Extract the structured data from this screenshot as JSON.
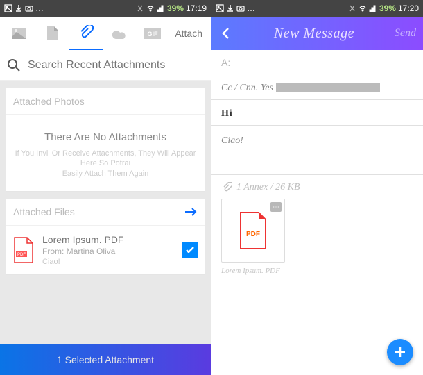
{
  "left": {
    "statusbar": {
      "battery": "39%",
      "time": "17:19"
    },
    "tabs": {
      "attach_label": "Attach"
    },
    "search": {
      "placeholder": "Search Recent Attachments"
    },
    "photos_card": {
      "header": "Attached Photos",
      "empty_title": "There Are No Attachments",
      "empty_sub1": "If You Invil Or Receive Attachments, They Will Appear Here So Potrai",
      "empty_sub2": "Easily Attach Them Again"
    },
    "files_card": {
      "header": "Attached Files",
      "file": {
        "name": "Lorem Ipsum. PDF",
        "from": "From: Martina Oliva",
        "snippet": "Ciao!",
        "pdf_label": "PDF"
      }
    },
    "bottom_bar": "1 Selected Attachment"
  },
  "right": {
    "statusbar": {
      "battery": "39%",
      "time": "17:20"
    },
    "compose": {
      "title": "New Message",
      "send": "Send"
    },
    "fields": {
      "to_label": "A:",
      "cc_label": "Cc / Cnn. Yes",
      "subject": "Hi",
      "body": "Ciao!"
    },
    "attachment": {
      "summary": "1 Annex / 26 KB",
      "pdf_label": "PDF",
      "caption": "Lorem Ipsum. PDF"
    }
  }
}
